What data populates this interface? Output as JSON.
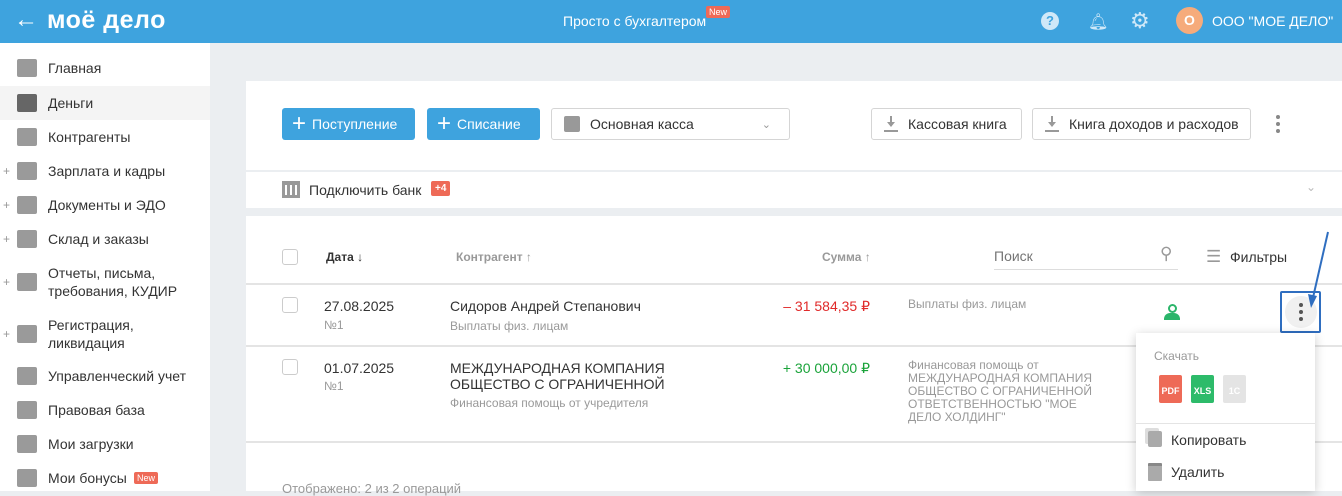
{
  "topbar": {
    "logo": "моё дело",
    "center_link": "Просто с бухгалтером",
    "center_badge": "New",
    "avatar_letter": "О",
    "company": "ООО \"МОЕ ДЕЛО\""
  },
  "sidebar": {
    "items": [
      {
        "label": "Главная"
      },
      {
        "label": "Деньги"
      },
      {
        "label": "Контрагенты"
      },
      {
        "label": "Зарплата и кадры"
      },
      {
        "label": "Документы и ЭДО"
      },
      {
        "label": "Склад и заказы"
      },
      {
        "label": "Отчеты, письма, требования, КУДИР"
      },
      {
        "label": "Регистрация, ликвидация"
      },
      {
        "label": "Управленческий учет"
      },
      {
        "label": "Правовая база"
      },
      {
        "label": "Мои загрузки"
      },
      {
        "label": "Мои бонусы",
        "badge": "New"
      }
    ]
  },
  "toolbar": {
    "income_label": "Поступление",
    "expense_label": "Списание",
    "cashbox_select": "Основная касса",
    "cash_book_label": "Кассовая книга",
    "income_book_label": "Книга доходов и расходов"
  },
  "bank": {
    "label": "Подключить банк",
    "badge": "+4"
  },
  "table": {
    "headers": {
      "date": "Дата ↓",
      "counterparty": "Контрагент ↑",
      "sum": "Сумма ↑"
    },
    "search_placeholder": "Поиск",
    "filters_label": "Фильтры",
    "rows": [
      {
        "date": "27.08.2025",
        "number": "№1",
        "counterparty": "Сидоров Андрей Степанович",
        "subtitle": "Выплаты физ. лицам",
        "amount": "– 31 584,35 ₽",
        "description": "Выплаты физ. лицам"
      },
      {
        "date": "01.07.2025",
        "number": "№1",
        "counterparty": "МЕЖДУНАРОДНАЯ КОМПАНИЯ ОБЩЕСТВО С ОГРАНИЧЕННОЙ",
        "subtitle": "Финансовая помощь от учредителя",
        "amount": "+ 30 000,00 ₽",
        "description": "Финансовая помощь от МЕЖДУНАРОДНАЯ КОМПАНИЯ ОБЩЕСТВО С ОГРАНИЧЕННОЙ ОТВЕТСТВЕННОСТЬЮ \"МОЕ ДЕЛО ХОЛДИНГ\""
      }
    ],
    "footer": "Отображено: 2 из 2 операций"
  },
  "menu": {
    "download_title": "Скачать",
    "formats": [
      "PDF",
      "XLS",
      "1C"
    ],
    "copy_label": "Копировать",
    "delete_label": "Удалить"
  },
  "colors": {
    "brand": "#3ea3de",
    "negative": "#e02a2a",
    "positive": "#1aa33a",
    "badge": "#ee6a57"
  }
}
